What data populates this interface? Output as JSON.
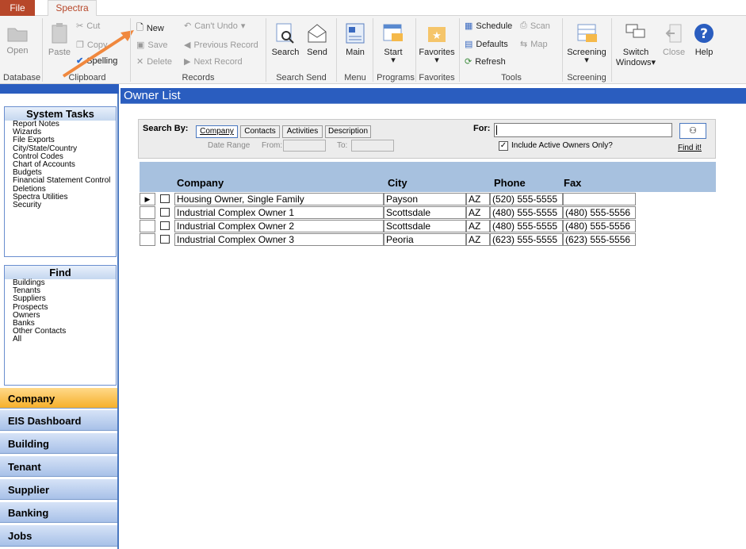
{
  "ribbon": {
    "tabs": {
      "file": "File",
      "spectra": "Spectra"
    },
    "database": {
      "open": "Open",
      "group": "Database"
    },
    "clipboard": {
      "paste": "Paste",
      "cut": "Cut",
      "copy": "Copy",
      "spelling": "Spelling",
      "group": "Clipboard"
    },
    "records": {
      "new": "New",
      "save": "Save",
      "delete": "Delete",
      "cant_undo": "Can't Undo",
      "previous": "Previous Record",
      "next": "Next Record",
      "group": "Records"
    },
    "search_send": {
      "search": "Search",
      "send": "Send",
      "group": "Search Send"
    },
    "menu": {
      "main": "Main",
      "group": "Menu"
    },
    "programs": {
      "start": "Start",
      "group": "Programs"
    },
    "favorites": {
      "favorites": "Favorites",
      "group": "Favorites"
    },
    "tools": {
      "schedule": "Schedule",
      "scan": "Scan",
      "defaults": "Defaults",
      "map": "Map",
      "refresh": "Refresh",
      "group": "Tools"
    },
    "screening": {
      "screening": "Screening",
      "group": "Screening"
    },
    "window": {
      "switch": "Switch",
      "windows": "Windows",
      "close": "Close",
      "help": "Help"
    }
  },
  "sidebar": {
    "system_tasks": {
      "title": "System Tasks",
      "items": [
        "Report Notes",
        "Wizards",
        "File Exports",
        "City/State/Country",
        "Control Codes",
        "Chart of Accounts",
        "Budgets",
        "Financial Statement Control",
        "Deletions",
        "Spectra Utilities",
        "Security"
      ]
    },
    "find": {
      "title": "Find",
      "items": [
        "Buildings",
        "Tenants",
        "Suppliers",
        "Prospects",
        "Owners",
        "Banks",
        "Other Contacts",
        "All"
      ]
    },
    "nav": [
      "Company",
      "EIS Dashboard",
      "Building",
      "Tenant",
      "Supplier",
      "Banking",
      "Jobs"
    ]
  },
  "main": {
    "title": "Owner List",
    "search": {
      "search_by": "Search By:",
      "buttons": [
        "Company",
        "Contacts",
        "Activities",
        "Description"
      ],
      "date_range": "Date Range",
      "from": "From:",
      "to": "To:",
      "for": "For:",
      "for_value": "",
      "include_active": "Include Active Owners Only?",
      "include_active_checked": true,
      "find_it": "Find it!"
    },
    "columns": [
      "Company",
      "City",
      "Phone",
      "Fax"
    ],
    "rows": [
      {
        "company": "Housing Owner, Single Family",
        "city": "Payson",
        "state": "AZ",
        "phone": "(520) 555-5555",
        "fax": ""
      },
      {
        "company": "Industrial Complex Owner 1",
        "city": "Scottsdale",
        "state": "AZ",
        "phone": "(480) 555-5555",
        "fax": "(480) 555-5556"
      },
      {
        "company": "Industrial Complex Owner 2",
        "city": "Scottsdale",
        "state": "AZ",
        "phone": "(480) 555-5555",
        "fax": "(480) 555-5556"
      },
      {
        "company": "Industrial Complex Owner 3",
        "city": "Peoria",
        "state": "AZ",
        "phone": "(623) 555-5555",
        "fax": "(623) 555-5556"
      }
    ]
  }
}
